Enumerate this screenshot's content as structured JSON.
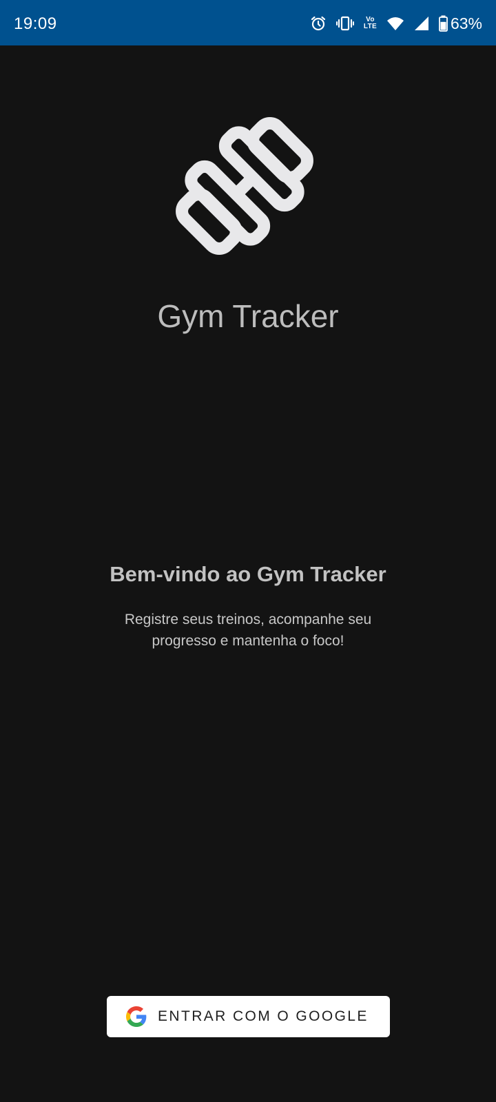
{
  "status_bar": {
    "time": "19:09",
    "icons": [
      "alarm-icon",
      "vibrate-icon",
      "volte-icon",
      "wifi-icon",
      "signal-icon",
      "battery-icon"
    ],
    "volte_top": "Vo",
    "volte_bottom": "LTE",
    "battery_percent": "63%",
    "battery_level": 0.63,
    "background_color": "#00518f"
  },
  "app": {
    "logo_icon": "dumbbell-icon",
    "title": "Gym Tracker"
  },
  "welcome": {
    "title": "Bem-vindo ao Gym Tracker",
    "subtitle_line1": "Registre seus treinos, acompanhe seu",
    "subtitle_line2": "progresso e mantenha o foco!"
  },
  "login": {
    "google_button_label": "ENTRAR COM O GOOGLE",
    "google_icon": "google-g-icon"
  },
  "colors": {
    "background": "#131313",
    "text": "#bdbdbd",
    "button_bg": "#ffffff"
  }
}
